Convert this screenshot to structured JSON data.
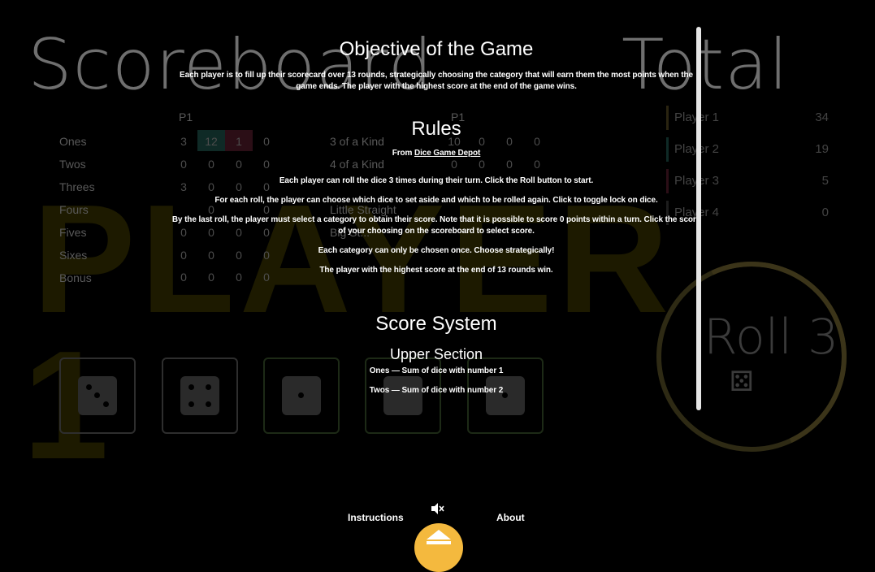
{
  "background": {
    "scoreboard_title": "Scoreboard",
    "total_title": "Total",
    "player_watermark": "PLAYER",
    "player_number_watermark": "1",
    "column_header_left": "P1",
    "column_header_right": "P1",
    "upper_rows": [
      "Ones",
      "Twos",
      "Threes",
      "Fours",
      "Fives",
      "Sixes",
      "Bonus"
    ],
    "upper_values": [
      [
        "3",
        "12",
        "1",
        "0"
      ],
      [
        "0",
        "0",
        "0",
        "0"
      ],
      [
        "3",
        "0",
        "0",
        "0"
      ],
      [
        "",
        "0",
        "",
        "0"
      ],
      [
        "0",
        "0",
        "0",
        "0"
      ],
      [
        "0",
        "0",
        "0",
        "0"
      ],
      [
        "0",
        "0",
        "0",
        "0"
      ]
    ],
    "lower_rows": [
      "3 of a Kind",
      "4 of a Kind",
      "",
      "Little Straight",
      "Big St..."
    ],
    "lower_values": [
      [
        "10",
        "0",
        "0",
        "0"
      ],
      [
        "0",
        "0",
        "0",
        "0"
      ]
    ],
    "players": [
      {
        "name": "Player 1",
        "score": "34"
      },
      {
        "name": "Player 2",
        "score": "19"
      },
      {
        "name": "Player 3",
        "score": "5"
      },
      {
        "name": "Player 4",
        "score": "0"
      }
    ],
    "roll_label": "Roll 3"
  },
  "instructions": {
    "objective_title": "Objective of the Game",
    "objective_text": "Each player is to fill up their scorecard over 13 rounds, strategically choosing the category that will earn them the most points when the game ends. The player with the highest score at the end of the game wins.",
    "rules_title": "Rules",
    "rules_from": "From",
    "rules_source": "Dice Game Depot",
    "rules": [
      "Each player can roll the dice 3 times during their turn. Click the Roll button to start.",
      "For each roll, the player can choose which dice to set aside and which to be rolled again. Click to toggle lock on dice.",
      "By the last roll, the player must select a category to obtain their score. Note that it is possible to score 0 points within a turn. Click the score of your choosing on the scoreboard to select score.",
      "Each category can only be chosen once. Choose strategically!",
      "The player with the highest score at the end of 13 rounds win."
    ],
    "score_title": "Score System",
    "upper_title": "Upper Section",
    "upper_items": [
      "Ones — Sum of dice with number 1",
      "Twos — Sum of dice with number 2"
    ]
  },
  "footer": {
    "instructions_label": "Instructions",
    "about_label": "About",
    "mute_icon": "mute-icon",
    "toggle_icon": "eject-icon"
  },
  "colors": {
    "accent": "#f4b93e",
    "background": "#000000"
  }
}
